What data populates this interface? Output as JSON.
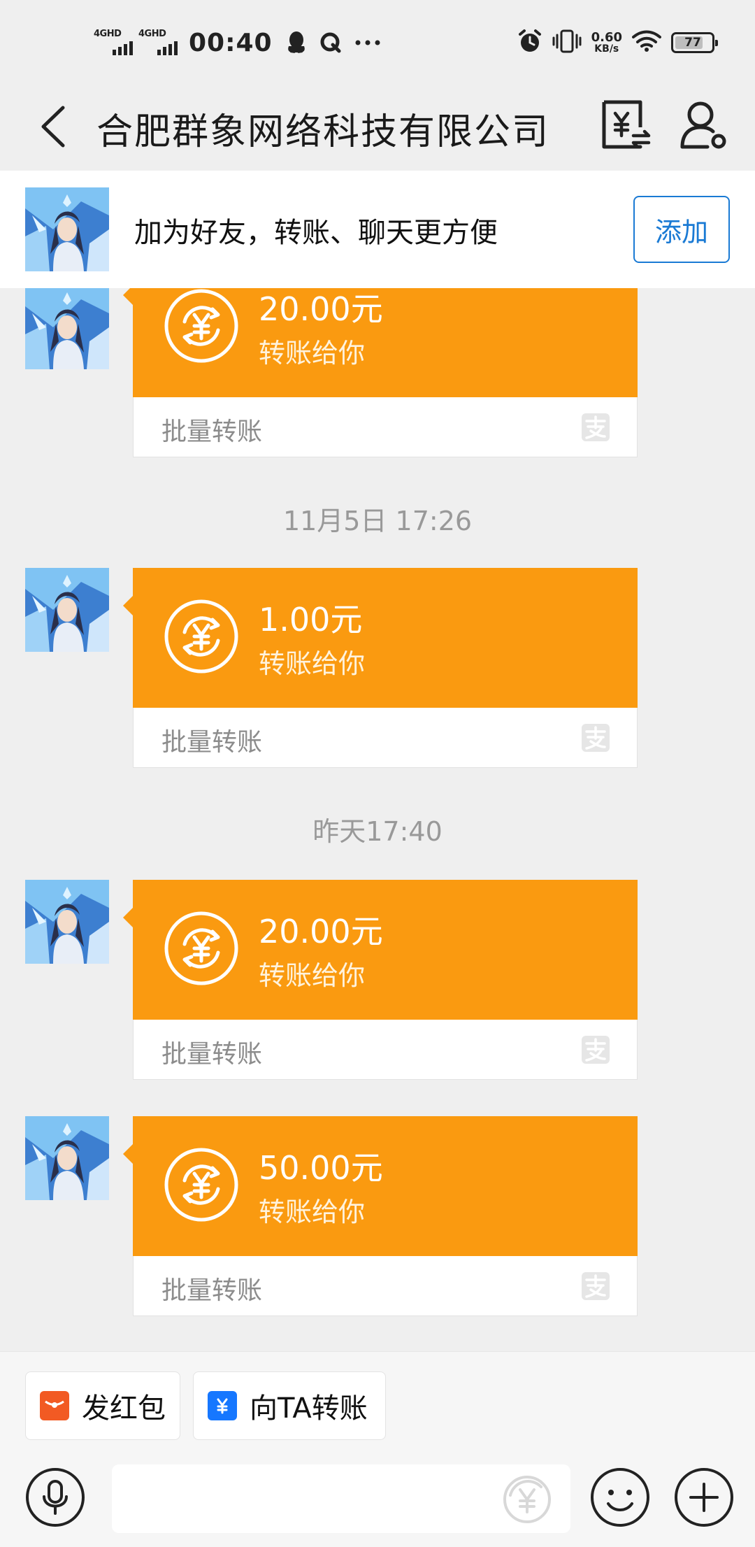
{
  "status_bar": {
    "signal1": "4GHD",
    "signal2": "4GHD",
    "time": "00:40",
    "net_speed_value": "0.60",
    "net_speed_unit": "KB/s",
    "battery": "77",
    "battery_level": 0.77
  },
  "header": {
    "title": "合肥群象网络科技有限公司"
  },
  "banner": {
    "message": "加为好友，转账、聊天更方便",
    "add_label": "添加"
  },
  "messages": [
    {
      "amount": "20.00元",
      "subtitle": "转账给你",
      "footer": "批量转账"
    },
    {
      "timestamp": "11月5日  17:26"
    },
    {
      "amount": "1.00元",
      "subtitle": "转账给你",
      "footer": "批量转账"
    },
    {
      "timestamp": "昨天17:40"
    },
    {
      "amount": "20.00元",
      "subtitle": "转账给你",
      "footer": "批量转账"
    },
    {
      "amount": "50.00元",
      "subtitle": "转账给你",
      "footer": "批量转账"
    }
  ],
  "quick_actions": {
    "red_packet": "发红包",
    "transfer": "向TA转账"
  },
  "input": {
    "placeholder": ""
  },
  "colors": {
    "card_orange": "#fa9a10",
    "accent_blue": "#1a7ad4",
    "red_packet": "#f25a23",
    "transfer_blue": "#1677ff"
  }
}
